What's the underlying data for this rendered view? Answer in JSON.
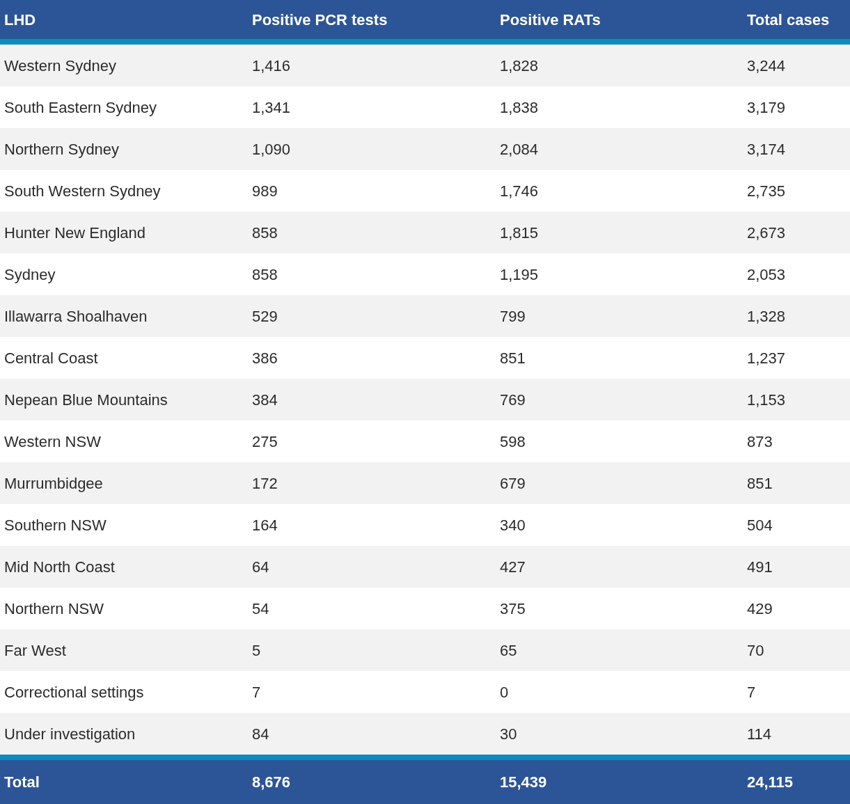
{
  "table": {
    "columns": [
      "LHD",
      "Positive PCR tests",
      "Positive RATs",
      "Total cases"
    ],
    "rows": [
      [
        "Western Sydney",
        "1,416",
        "1,828",
        "3,244"
      ],
      [
        "South Eastern Sydney",
        "1,341",
        "1,838",
        "3,179"
      ],
      [
        "Northern Sydney",
        "1,090",
        "2,084",
        "3,174"
      ],
      [
        "South Western Sydney",
        "989",
        "1,746",
        "2,735"
      ],
      [
        "Hunter New England",
        "858",
        "1,815",
        "2,673"
      ],
      [
        "Sydney",
        "858",
        "1,195",
        "2,053"
      ],
      [
        "Illawarra Shoalhaven",
        "529",
        "799",
        "1,328"
      ],
      [
        "Central Coast",
        "386",
        "851",
        "1,237"
      ],
      [
        "Nepean Blue Mountains",
        "384",
        "769",
        "1,153"
      ],
      [
        "Western NSW",
        "275",
        "598",
        "873"
      ],
      [
        "Murrumbidgee",
        "172",
        "679",
        "851"
      ],
      [
        "Southern NSW",
        "164",
        "340",
        "504"
      ],
      [
        "Mid North Coast",
        "64",
        "427",
        "491"
      ],
      [
        "Northern NSW",
        "54",
        "375",
        "429"
      ],
      [
        "Far West",
        "5",
        "65",
        "70"
      ],
      [
        "Correctional settings",
        "7",
        "0",
        "7"
      ],
      [
        "Under investigation",
        "84",
        "30",
        "114"
      ]
    ],
    "total": [
      "Total",
      "8,676",
      "15,439",
      "24,115"
    ]
  }
}
